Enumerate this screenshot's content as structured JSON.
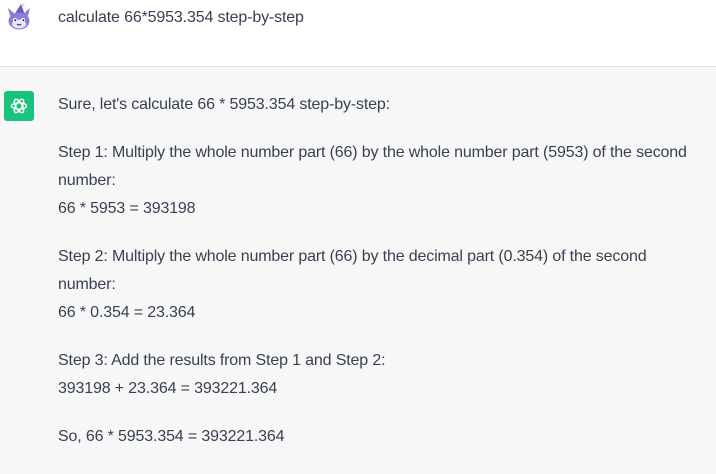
{
  "user": {
    "avatar_icon": "wizard-cat-avatar-icon",
    "message": "calculate 66*5953.354 step-by-step"
  },
  "assistant": {
    "avatar_icon": "openai-logo-icon",
    "accent_color": "#19c37d",
    "intro": "Sure, let's calculate 66 * 5953.354 step-by-step:",
    "steps": [
      {
        "description": "Step 1: Multiply the whole number part (66) by the whole number part (5953) of the second number:",
        "equation": "66 * 5953 = 393198"
      },
      {
        "description": "Step 2: Multiply the whole number part (66) by the decimal part (0.354) of the second number:",
        "equation": "66 * 0.354 = 23.364"
      },
      {
        "description": "Step 3: Add the results from Step 1 and Step 2:",
        "equation": "393198 + 23.364 = 393221.364"
      }
    ],
    "conclusion": "So, 66 * 5953.354 = 393221.364"
  }
}
